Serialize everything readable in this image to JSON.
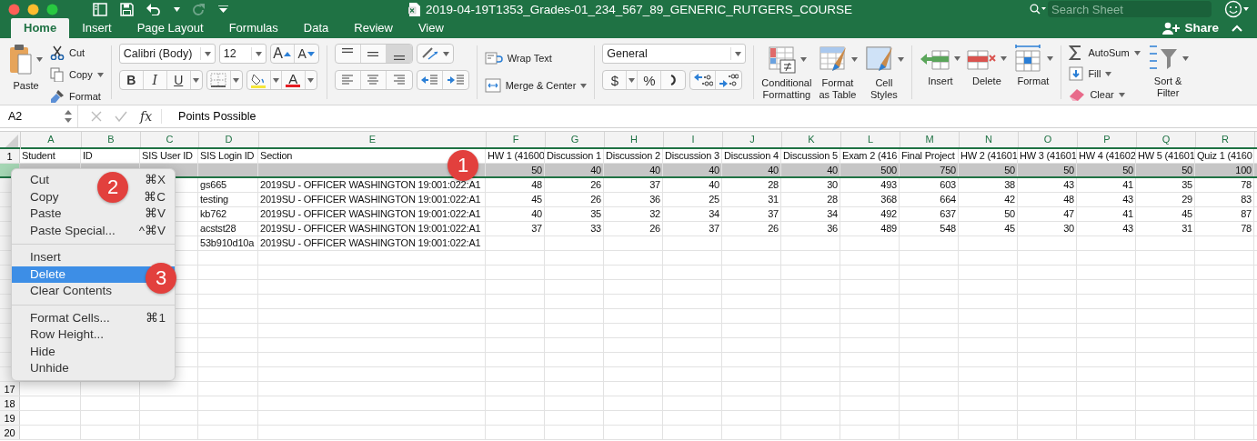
{
  "window": {
    "title": "2019-04-19T1353_Grades-01_234_567_89_GENERIC_RUTGERS_COURSE",
    "search_placeholder": "Search Sheet"
  },
  "tabs": [
    {
      "label": "Home",
      "selected": true
    },
    {
      "label": "Insert",
      "selected": false
    },
    {
      "label": "Page Layout",
      "selected": false
    },
    {
      "label": "Formulas",
      "selected": false
    },
    {
      "label": "Data",
      "selected": false
    },
    {
      "label": "Review",
      "selected": false
    },
    {
      "label": "View",
      "selected": false
    }
  ],
  "share": "Share",
  "ribbon": {
    "clipboard": {
      "paste": "Paste",
      "items": [
        {
          "kind": "cut",
          "label": "Cut"
        },
        {
          "kind": "copy",
          "label": "Copy"
        },
        {
          "kind": "format",
          "label": "Format"
        }
      ]
    },
    "font": {
      "family": "Calibri (Body)",
      "size": "12",
      "grow": "A",
      "shrink": "A",
      "styles": [
        "B",
        "I",
        "U"
      ],
      "color_letter": "A"
    },
    "vertical_align": [
      {
        "kind": "top",
        "selected": false
      },
      {
        "kind": "middle",
        "selected": false
      },
      {
        "kind": "bottom",
        "selected": true
      }
    ],
    "wrap_text": "Wrap Text",
    "merge_center": "Merge & Center",
    "number": {
      "format": "General",
      "currency": "$",
      "percent": "%"
    },
    "styles": [
      {
        "kind": "conditional",
        "lines": [
          "Conditional",
          "Formatting"
        ]
      },
      {
        "kind": "table",
        "lines": [
          "Format",
          "as Table"
        ]
      },
      {
        "kind": "cell",
        "lines": [
          "Cell",
          "Styles"
        ]
      }
    ],
    "cells": [
      {
        "kind": "insert",
        "label": "Insert"
      },
      {
        "kind": "delete",
        "label": "Delete"
      },
      {
        "kind": "format",
        "label": "Format"
      }
    ],
    "editing": {
      "autosum": "AutoSum",
      "fill": "Fill",
      "clear": "Clear",
      "sort_filter": [
        "Sort &",
        "Filter"
      ]
    }
  },
  "formula_bar": {
    "cell_ref": "A2",
    "fx": "fx",
    "formula": "Points Possible"
  },
  "sheet": {
    "columns": [
      "A",
      "B",
      "C",
      "D",
      "E",
      "F",
      "G",
      "H",
      "I",
      "J",
      "K",
      "L",
      "M",
      "N",
      "O",
      "P",
      "Q",
      "R"
    ],
    "rows": [
      {
        "number": "1",
        "selected": false,
        "text": {
          "A": "Student",
          "B": "ID",
          "C": "SIS User ID",
          "D": "SIS Login ID",
          "E": "Section",
          "F": "HW 1 (41600",
          "G": "Discussion 1",
          "H": "Discussion 2",
          "I": "Discussion 3",
          "J": "Discussion 4",
          "K": "Discussion 5",
          "L": "Exam 2 (416",
          "M": "Final Project",
          "N": "HW 2 (41601",
          "O": "HW 3 (41601",
          "P": "HW 4 (41602",
          "Q": "HW 5 (41601",
          "R": "Quiz 1 (4160"
        }
      },
      {
        "selected": true,
        "numbers": {
          "F": "50",
          "G": "40",
          "H": "40",
          "I": "40",
          "J": "40",
          "K": "40",
          "L": "500",
          "M": "750",
          "N": "50",
          "O": "50",
          "P": "50",
          "Q": "50",
          "R": "100"
        }
      },
      {
        "selected": false,
        "text": {
          "D": "gs665",
          "E": "2019SU - OFFICER WASHINGTON 19:001:022:A1"
        },
        "numbers": {
          "F": "48",
          "G": "26",
          "H": "37",
          "I": "40",
          "J": "28",
          "K": "30",
          "L": "493",
          "M": "603",
          "N": "38",
          "O": "43",
          "P": "41",
          "Q": "35",
          "R": "78"
        }
      },
      {
        "selected": false,
        "text": {
          "D": "testing",
          "E": "2019SU - OFFICER WASHINGTON 19:001:022:A1"
        },
        "numbers": {
          "F": "45",
          "G": "26",
          "H": "36",
          "I": "25",
          "J": "31",
          "K": "28",
          "L": "368",
          "M": "664",
          "N": "42",
          "O": "48",
          "P": "43",
          "Q": "29",
          "R": "83"
        }
      },
      {
        "selected": false,
        "text": {
          "D": "kb762",
          "E": "2019SU - OFFICER WASHINGTON 19:001:022:A1"
        },
        "numbers": {
          "F": "40",
          "G": "35",
          "H": "32",
          "I": "34",
          "J": "37",
          "K": "34",
          "L": "492",
          "M": "637",
          "N": "50",
          "O": "47",
          "P": "41",
          "Q": "45",
          "R": "87"
        }
      },
      {
        "selected": false,
        "text": {
          "D": "acstst28",
          "E": "2019SU - OFFICER WASHINGTON 19:001:022:A1"
        },
        "numbers": {
          "F": "37",
          "G": "33",
          "H": "26",
          "I": "37",
          "J": "26",
          "K": "36",
          "L": "489",
          "M": "548",
          "N": "45",
          "O": "30",
          "P": "43",
          "Q": "31",
          "R": "78"
        }
      },
      {
        "selected": false,
        "text": {
          "D": "53b910d10a",
          "E": "2019SU - OFFICER WASHINGTON 19:001:022:A1"
        }
      },
      {
        "selected": false
      },
      {
        "selected": false
      },
      {
        "selected": false
      },
      {
        "selected": false
      },
      {
        "selected": false
      },
      {
        "selected": false
      },
      {
        "selected": false
      },
      {
        "selected": false
      },
      {
        "selected": false
      },
      {
        "number": "17",
        "selected": false
      },
      {
        "number": "18",
        "selected": false
      },
      {
        "number": "19",
        "selected": false
      },
      {
        "number": "20",
        "selected": false
      }
    ]
  },
  "context_menu": {
    "groups": [
      [
        {
          "label": "Cut",
          "shortcut": "⌘X",
          "selected": false
        },
        {
          "label": "Copy",
          "shortcut": "⌘C",
          "selected": false
        },
        {
          "label": "Paste",
          "shortcut": "⌘V",
          "selected": false
        },
        {
          "label": "Paste Special...",
          "shortcut": "^⌘V",
          "selected": false
        }
      ],
      [
        {
          "label": "Insert",
          "selected": false
        },
        {
          "label": "Delete",
          "selected": true
        },
        {
          "label": "Clear Contents",
          "selected": false
        }
      ],
      [
        {
          "label": "Format Cells...",
          "shortcut": "⌘1",
          "selected": false
        },
        {
          "label": "Row Height...",
          "selected": false
        },
        {
          "label": "Hide",
          "selected": false
        },
        {
          "label": "Unhide",
          "selected": false
        }
      ]
    ]
  },
  "callouts": [
    "1",
    "2",
    "3"
  ]
}
